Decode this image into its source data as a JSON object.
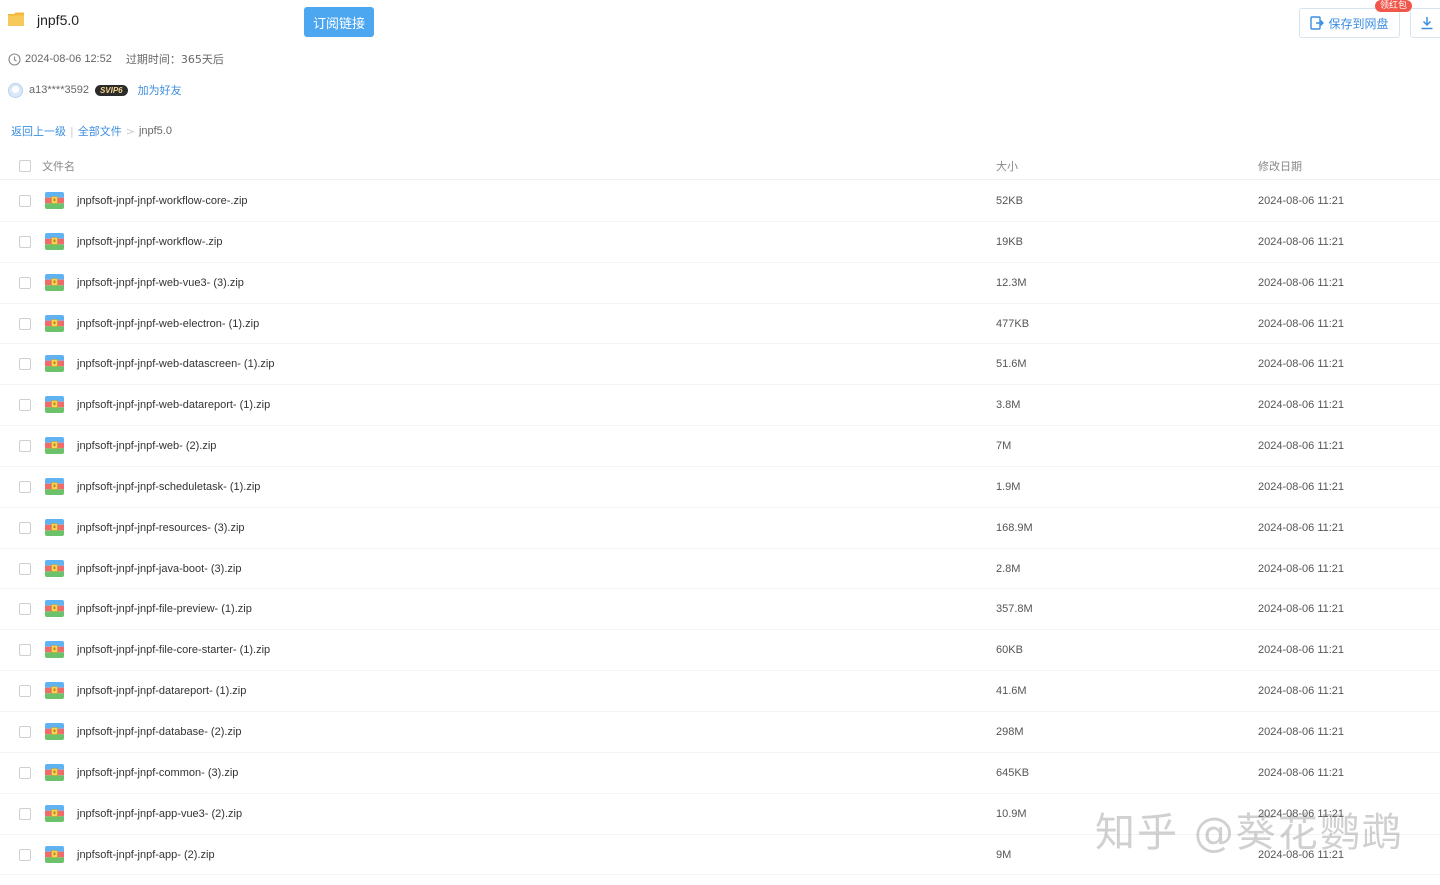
{
  "header": {
    "title": "jnpf5.0",
    "subscribe_label": "订阅链接",
    "save_label": "保存到网盘",
    "save_badge": "领红包"
  },
  "meta": {
    "datetime": "2024-08-06 12:52",
    "expire": "过期时间：365天后"
  },
  "user": {
    "name": "a13****3592",
    "vip": "SVIP6",
    "add_friend": "加为好友"
  },
  "breadcrumb": {
    "back": "返回上一级",
    "all_files": "全部文件",
    "sep": ">",
    "current": "jnpf5.0"
  },
  "table": {
    "col_name": "文件名",
    "col_size": "大小",
    "col_date": "修改日期",
    "rows": [
      {
        "name": "jnpfsoft-jnpf-jnpf-workflow-core-.zip",
        "size": "52KB",
        "date": "2024-08-06 11:21"
      },
      {
        "name": "jnpfsoft-jnpf-jnpf-workflow-.zip",
        "size": "19KB",
        "date": "2024-08-06 11:21"
      },
      {
        "name": "jnpfsoft-jnpf-jnpf-web-vue3- (3).zip",
        "size": "12.3M",
        "date": "2024-08-06 11:21"
      },
      {
        "name": "jnpfsoft-jnpf-jnpf-web-electron- (1).zip",
        "size": "477KB",
        "date": "2024-08-06 11:21"
      },
      {
        "name": "jnpfsoft-jnpf-jnpf-web-datascreen- (1).zip",
        "size": "51.6M",
        "date": "2024-08-06 11:21"
      },
      {
        "name": "jnpfsoft-jnpf-jnpf-web-datareport- (1).zip",
        "size": "3.8M",
        "date": "2024-08-06 11:21"
      },
      {
        "name": "jnpfsoft-jnpf-jnpf-web- (2).zip",
        "size": "7M",
        "date": "2024-08-06 11:21"
      },
      {
        "name": "jnpfsoft-jnpf-jnpf-scheduletask- (1).zip",
        "size": "1.9M",
        "date": "2024-08-06 11:21"
      },
      {
        "name": "jnpfsoft-jnpf-jnpf-resources- (3).zip",
        "size": "168.9M",
        "date": "2024-08-06 11:21"
      },
      {
        "name": "jnpfsoft-jnpf-jnpf-java-boot- (3).zip",
        "size": "2.8M",
        "date": "2024-08-06 11:21"
      },
      {
        "name": "jnpfsoft-jnpf-jnpf-file-preview- (1).zip",
        "size": "357.8M",
        "date": "2024-08-06 11:21"
      },
      {
        "name": "jnpfsoft-jnpf-jnpf-file-core-starter- (1).zip",
        "size": "60KB",
        "date": "2024-08-06 11:21"
      },
      {
        "name": "jnpfsoft-jnpf-jnpf-datareport- (1).zip",
        "size": "41.6M",
        "date": "2024-08-06 11:21"
      },
      {
        "name": "jnpfsoft-jnpf-jnpf-database- (2).zip",
        "size": "298M",
        "date": "2024-08-06 11:21"
      },
      {
        "name": "jnpfsoft-jnpf-jnpf-common- (3).zip",
        "size": "645KB",
        "date": "2024-08-06 11:21"
      },
      {
        "name": "jnpfsoft-jnpf-jnpf-app-vue3- (2).zip",
        "size": "10.9M",
        "date": "2024-08-06 11:21"
      },
      {
        "name": "jnpfsoft-jnpf-jnpf-app- (2).zip",
        "size": "9M",
        "date": "2024-08-06 11:21"
      }
    ]
  },
  "watermark": "知乎 @葵花鹦鹉",
  "colors": {
    "accent": "#3b8ee0",
    "primary_button": "#4da7f0",
    "badge": "#f0564a"
  }
}
